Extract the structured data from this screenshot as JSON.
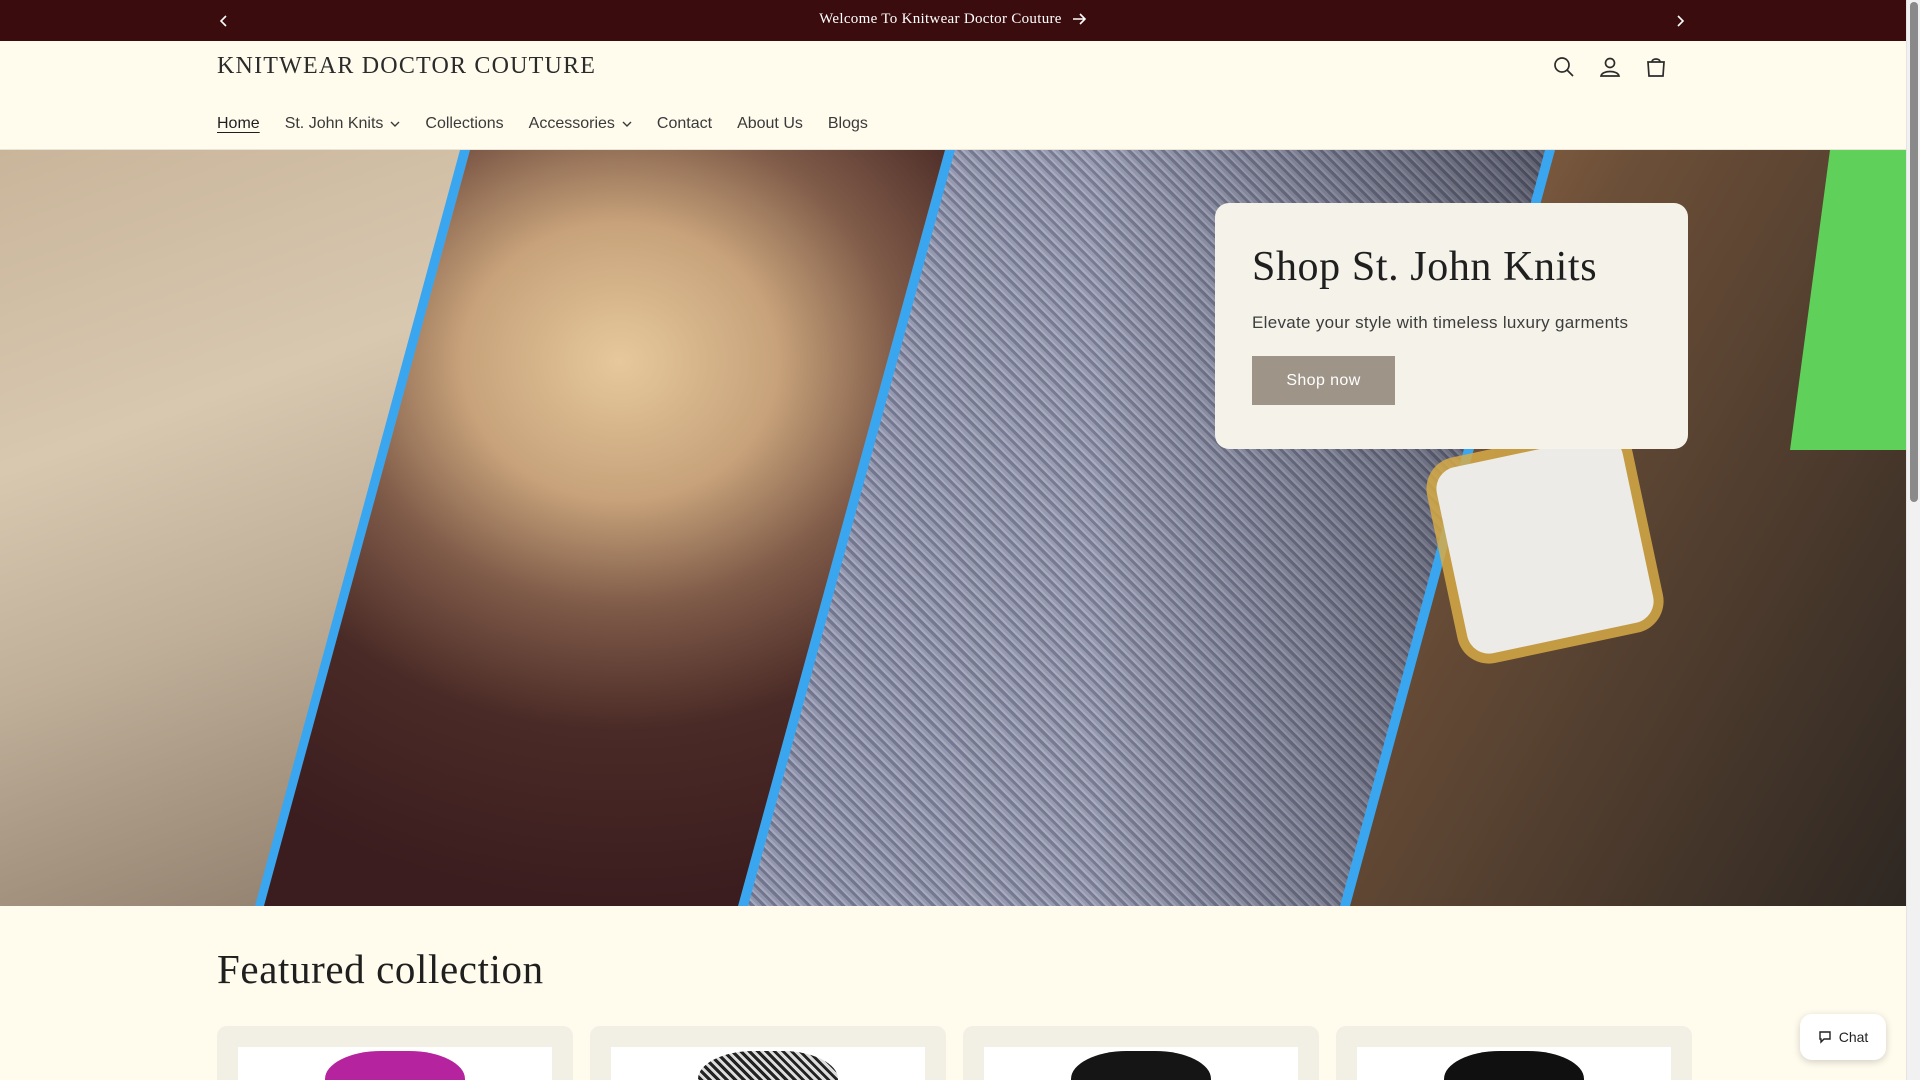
{
  "announcement": {
    "message": "Welcome To Knitwear Doctor Couture",
    "prev_icon": "chevron-left-icon",
    "next_icon": "chevron-right-icon"
  },
  "header": {
    "logo": "KNITWEAR DOCTOR COUTURE",
    "icons": [
      "search-icon",
      "account-icon",
      "cart-icon"
    ]
  },
  "nav": {
    "items": [
      {
        "label": "Home",
        "active": true,
        "dropdown": false
      },
      {
        "label": "St. John Knits",
        "active": false,
        "dropdown": true
      },
      {
        "label": "Collections",
        "active": false,
        "dropdown": false
      },
      {
        "label": "Accessories",
        "active": false,
        "dropdown": true
      },
      {
        "label": "Contact",
        "active": false,
        "dropdown": false
      },
      {
        "label": "About Us",
        "active": false,
        "dropdown": false
      },
      {
        "label": "Blogs",
        "active": false,
        "dropdown": false
      }
    ]
  },
  "hero": {
    "title": "Shop St. John Knits",
    "subtitle": "Elevate your style with timeless luxury garments",
    "button": "Shop now"
  },
  "featured": {
    "title": "Featured collection"
  },
  "chat": {
    "label": "Chat"
  },
  "colors": {
    "announcement_bg": "#3b0c0e",
    "page_bg": "#fffcee",
    "hero_stripe": "#3aa6ef",
    "button_bg": "#9e9488"
  }
}
